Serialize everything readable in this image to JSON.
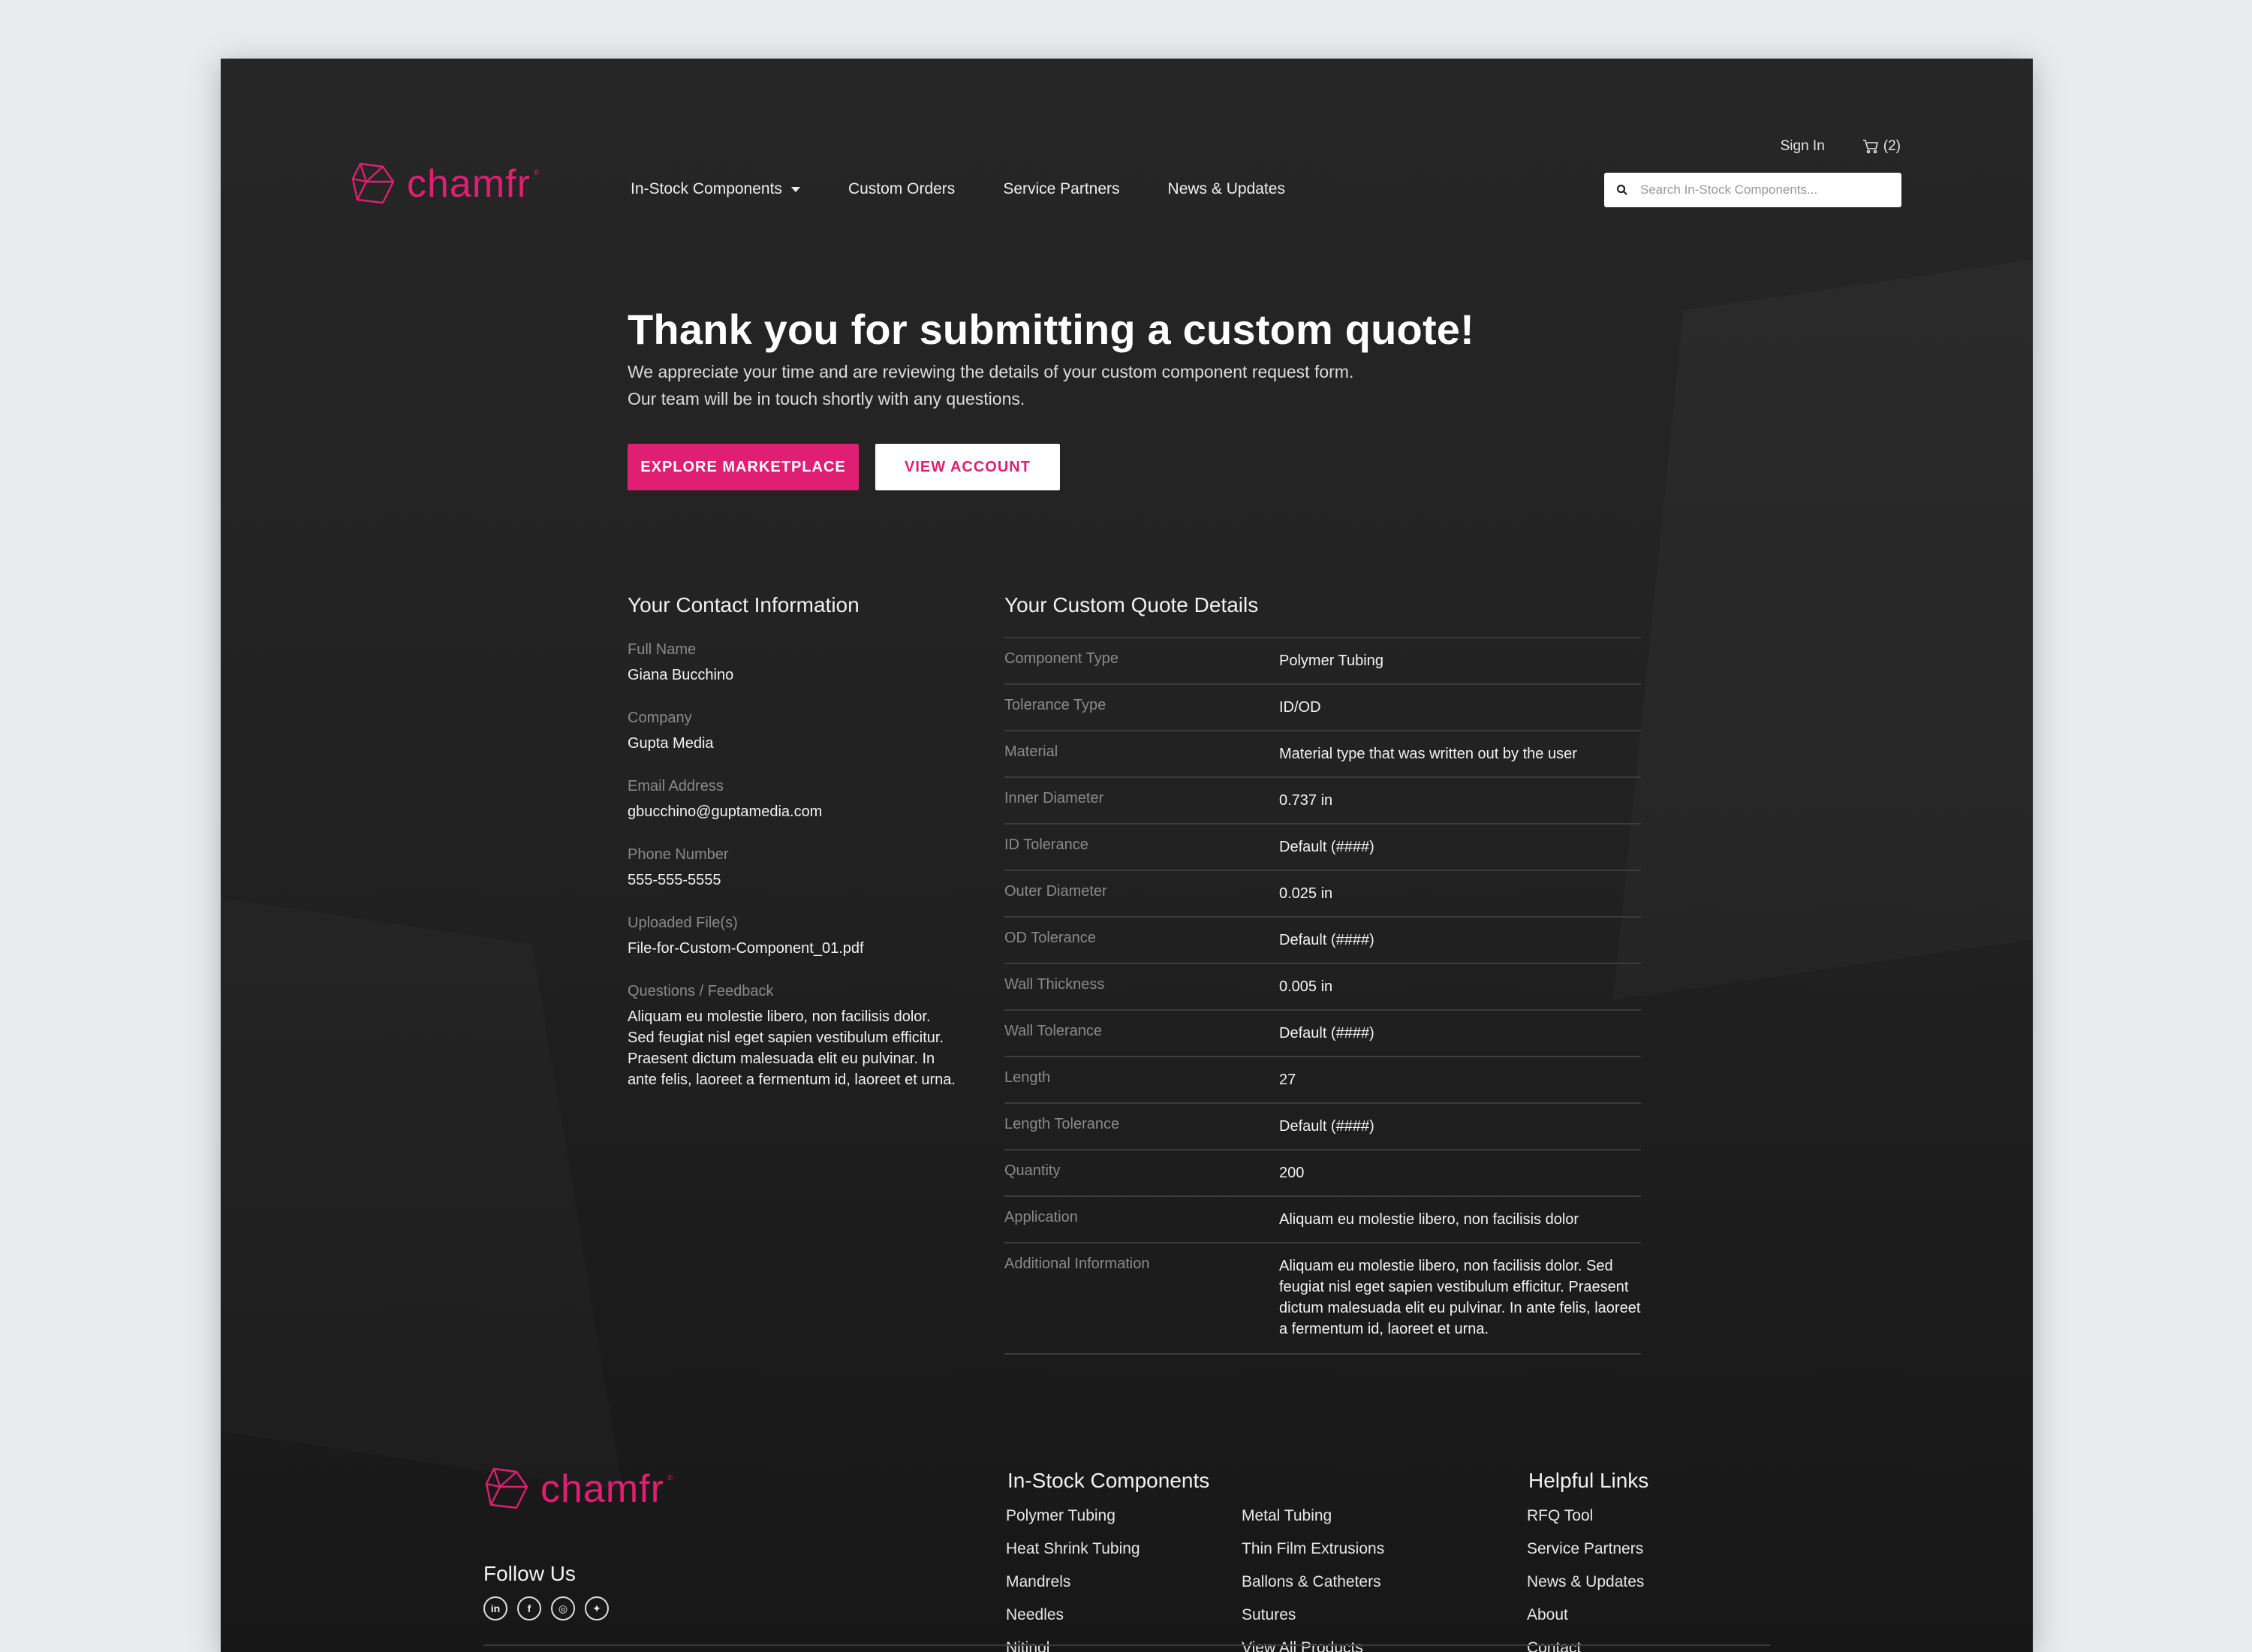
{
  "brand": {
    "name": "chamfr",
    "color": "#e01e73",
    "mark": "®"
  },
  "header": {
    "sign_in": "Sign In",
    "cart_count": "(2)",
    "nav": [
      {
        "label": "In-Stock Components"
      },
      {
        "label": "Custom Orders"
      },
      {
        "label": "Service Partners"
      },
      {
        "label": "News & Updates"
      }
    ],
    "search_placeholder": "Search In-Stock Components..."
  },
  "hero": {
    "title": "Thank you for submitting a custom quote!",
    "line1": "We appreciate your time and are reviewing the details of your custom component request form.",
    "line2": "Our team will be in touch shortly with any questions.",
    "primary_button": "EXPLORE MARKETPLACE",
    "secondary_button": "VIEW ACCOUNT"
  },
  "contact": {
    "title": "Your Contact Information",
    "fields": [
      {
        "label": "Full Name",
        "value": "Giana Bucchino"
      },
      {
        "label": "Company",
        "value": "Gupta Media"
      },
      {
        "label": "Email Address",
        "value": "gbucchino@guptamedia.com"
      },
      {
        "label": "Phone Number",
        "value": "555-555-5555"
      },
      {
        "label": "Uploaded File(s)",
        "value": "File-for-Custom-Component_01.pdf"
      },
      {
        "label": "Questions / Feedback",
        "value": "Aliquam eu molestie libero, non facilisis dolor. Sed feugiat nisl eget sapien vestibulum efficitur. Praesent dictum malesuada elit eu pulvinar. In ante felis, laoreet a fermentum id, laoreet et urna."
      }
    ]
  },
  "quote": {
    "title": "Your Custom Quote Details",
    "rows": [
      {
        "key": "Component Type",
        "value": "Polymer Tubing"
      },
      {
        "key": "Tolerance Type",
        "value": "ID/OD"
      },
      {
        "key": "Material",
        "value": "Material type that was written out by the user"
      },
      {
        "key": "Inner Diameter",
        "value": "0.737 in"
      },
      {
        "key": "ID Tolerance",
        "value": "Default (####)"
      },
      {
        "key": "Outer Diameter",
        "value": "0.025 in"
      },
      {
        "key": "OD Tolerance",
        "value": "Default (####)"
      },
      {
        "key": "Wall Thickness",
        "value": "0.005 in"
      },
      {
        "key": "Wall Tolerance",
        "value": "Default (####)"
      },
      {
        "key": "Length",
        "value": "27"
      },
      {
        "key": "Length Tolerance",
        "value": "Default (####)"
      },
      {
        "key": "Quantity",
        "value": "200"
      },
      {
        "key": "Application",
        "value": "Aliquam eu molestie libero, non facilisis dolor"
      },
      {
        "key": "Additional Information",
        "value": "Aliquam eu molestie libero, non facilisis dolor. Sed feugiat nisl eget sapien vestibulum efficitur. Praesent dictum malesuada elit eu pulvinar. In ante felis, laoreet a fermentum id, laoreet et urna."
      }
    ]
  },
  "footer": {
    "follow_us": "Follow Us",
    "socials": [
      {
        "icon": "linkedin-icon",
        "glyph": "in"
      },
      {
        "icon": "facebook-icon",
        "glyph": "f"
      },
      {
        "icon": "instagram-icon",
        "glyph": "◎"
      },
      {
        "icon": "twitter-icon",
        "glyph": "✦"
      }
    ],
    "components_title": "In-Stock Components",
    "components_col1": [
      "Polymer Tubing",
      "Heat Shrink Tubing",
      "Mandrels",
      "Needles",
      "Nitinol"
    ],
    "components_col2": [
      "Metal Tubing",
      "Thin Film Extrusions",
      "Ballons & Catheters",
      "Sutures",
      "View All Products"
    ],
    "helpful_title": "Helpful Links",
    "helpful_links": [
      "RFQ Tool",
      "Service Partners",
      "News & Updates",
      "About",
      "Contact"
    ]
  }
}
